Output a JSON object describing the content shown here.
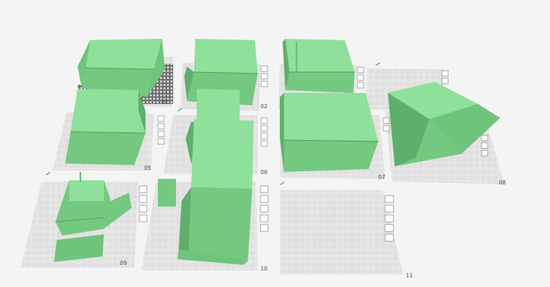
{
  "app": {
    "view": "3D build plate overview",
    "accent_color": "#7fd48a",
    "plate_grid_color": "#d8d8d8",
    "model_color": "#7fd48a"
  },
  "plates": [
    {
      "id": "01",
      "label": "01"
    },
    {
      "id": "02",
      "label": "02"
    },
    {
      "id": "03",
      "label": ""
    },
    {
      "id": "04",
      "label": ""
    },
    {
      "id": "05",
      "label": "05"
    },
    {
      "id": "06",
      "label": "06"
    },
    {
      "id": "07",
      "label": "07"
    },
    {
      "id": "08",
      "label": "08"
    },
    {
      "id": "09",
      "label": "09"
    },
    {
      "id": "10",
      "label": "10"
    },
    {
      "id": "11",
      "label": "11"
    }
  ],
  "plate_toolbar_icons": [
    "close-icon",
    "auto-arrange-icon",
    "grid-icon",
    "lock-icon",
    "settings-icon"
  ]
}
